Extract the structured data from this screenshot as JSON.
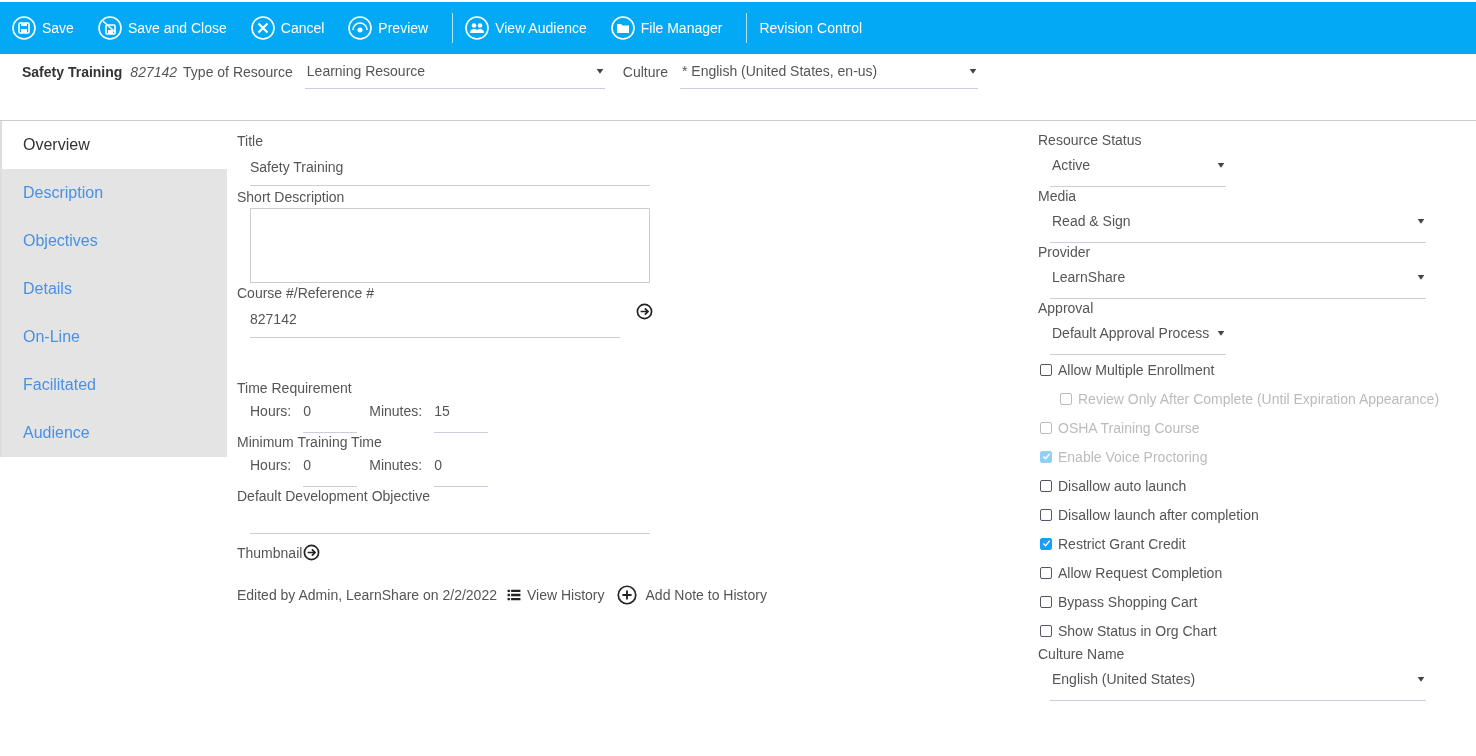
{
  "toolbar": {
    "groups": [
      [
        {
          "label": "Save"
        },
        {
          "label": "Save and Close"
        },
        {
          "label": "Cancel"
        },
        {
          "label": "Preview"
        }
      ],
      [
        {
          "label": "View Audience"
        },
        {
          "label": "File Manager"
        }
      ],
      [
        {
          "label": "Revision Control"
        }
      ]
    ]
  },
  "header": {
    "title": "Safety Training",
    "number": "827142",
    "type_label": "Type of Resource",
    "type_value": "Learning Resource",
    "culture_label": "Culture",
    "culture_value": "* English (United States, en-us)"
  },
  "tabs": [
    {
      "label": "Overview",
      "selected": true
    },
    {
      "label": "Description",
      "selected": false
    },
    {
      "label": "Objectives",
      "selected": false
    },
    {
      "label": "Details",
      "selected": false
    },
    {
      "label": "On-Line",
      "selected": false
    },
    {
      "label": "Facilitated",
      "selected": false
    },
    {
      "label": "Audience",
      "selected": false
    }
  ],
  "form": {
    "title_label": "Title",
    "title_value": "Safety Training",
    "short_description_label": "Short Description",
    "course_label": "Course #/Reference #",
    "course_value": "827142",
    "times": [
      {
        "label": "Time Requirement",
        "hours_label": "Hours:",
        "hours": "0",
        "minutes_label": "Minutes:",
        "minutes": "15"
      },
      {
        "label": "Minimum Training Time",
        "hours_label": "Hours:",
        "hours": "0",
        "minutes_label": "Minutes:",
        "minutes": "0"
      }
    ],
    "objective_label": "Default Development Objective",
    "thumbnail_label": "Thumbnail",
    "edited_text": "Edited by Admin, LearnShare on 2/2/2022",
    "view_history": "View History",
    "add_note": "Add Note to History"
  },
  "settings": [
    {
      "kind": "select",
      "label": "Resource Status",
      "value": "Active",
      "compact": true
    },
    {
      "kind": "select",
      "label": "Media",
      "value": "Read & Sign",
      "compact": false
    },
    {
      "kind": "select",
      "label": "Provider",
      "value": "LearnShare",
      "compact": false
    },
    {
      "kind": "select",
      "label": "Approval",
      "value": "Default Approval Process",
      "compact": true
    },
    {
      "kind": "checkbox",
      "label": "Allow Multiple Enrollment",
      "checked": false,
      "disabled": false,
      "children": [
        {
          "kind": "checkbox",
          "label": "Review Only After Complete (Until Expiration Appearance)",
          "checked": false,
          "disabled": true
        }
      ]
    },
    {
      "kind": "checkbox",
      "label": "OSHA Training Course",
      "checked": false,
      "disabled": true
    },
    {
      "kind": "checkbox",
      "label": "Enable Voice Proctoring",
      "checked": true,
      "disabled": true
    },
    {
      "kind": "checkbox",
      "label": "Disallow auto launch",
      "checked": false,
      "disabled": false
    },
    {
      "kind": "checkbox",
      "label": "Disallow launch after completion",
      "checked": false,
      "disabled": false
    },
    {
      "kind": "checkbox",
      "label": "Restrict Grant Credit",
      "checked": true,
      "disabled": false
    },
    {
      "kind": "checkbox",
      "label": "Allow Request Completion",
      "checked": false,
      "disabled": false
    },
    {
      "kind": "checkbox",
      "label": "Bypass Shopping Cart",
      "checked": false,
      "disabled": false
    },
    {
      "kind": "checkbox",
      "label": "Show Status in Org Chart",
      "checked": false,
      "disabled": false
    },
    {
      "kind": "select",
      "label": "Culture Name",
      "value": "English (United States)",
      "compact": false
    }
  ]
}
